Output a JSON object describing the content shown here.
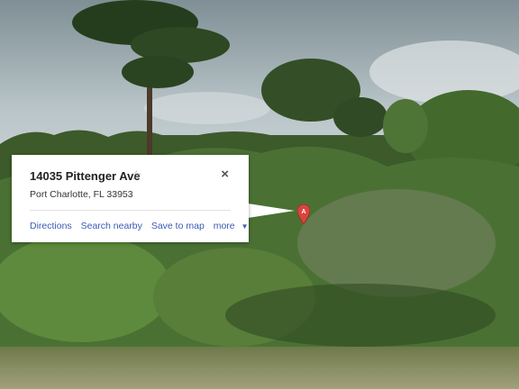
{
  "infowindow": {
    "title": "14035 Pittenger Ave",
    "address": "Port Charlotte, FL 33953",
    "close_icon": "close-icon",
    "star_icon": "star-outline-icon",
    "links": {
      "directions": "Directions",
      "search_nearby": "Search nearby",
      "save_to_map": "Save to map",
      "more": "more"
    }
  },
  "marker": {
    "icon": "map-pin-icon",
    "label": "A",
    "color": "#d9453d"
  },
  "colors": {
    "sky": "#c2ccd0",
    "foliage": "#3f6b2c",
    "ground": "#8f8f66",
    "link": "#3b5ab6"
  }
}
